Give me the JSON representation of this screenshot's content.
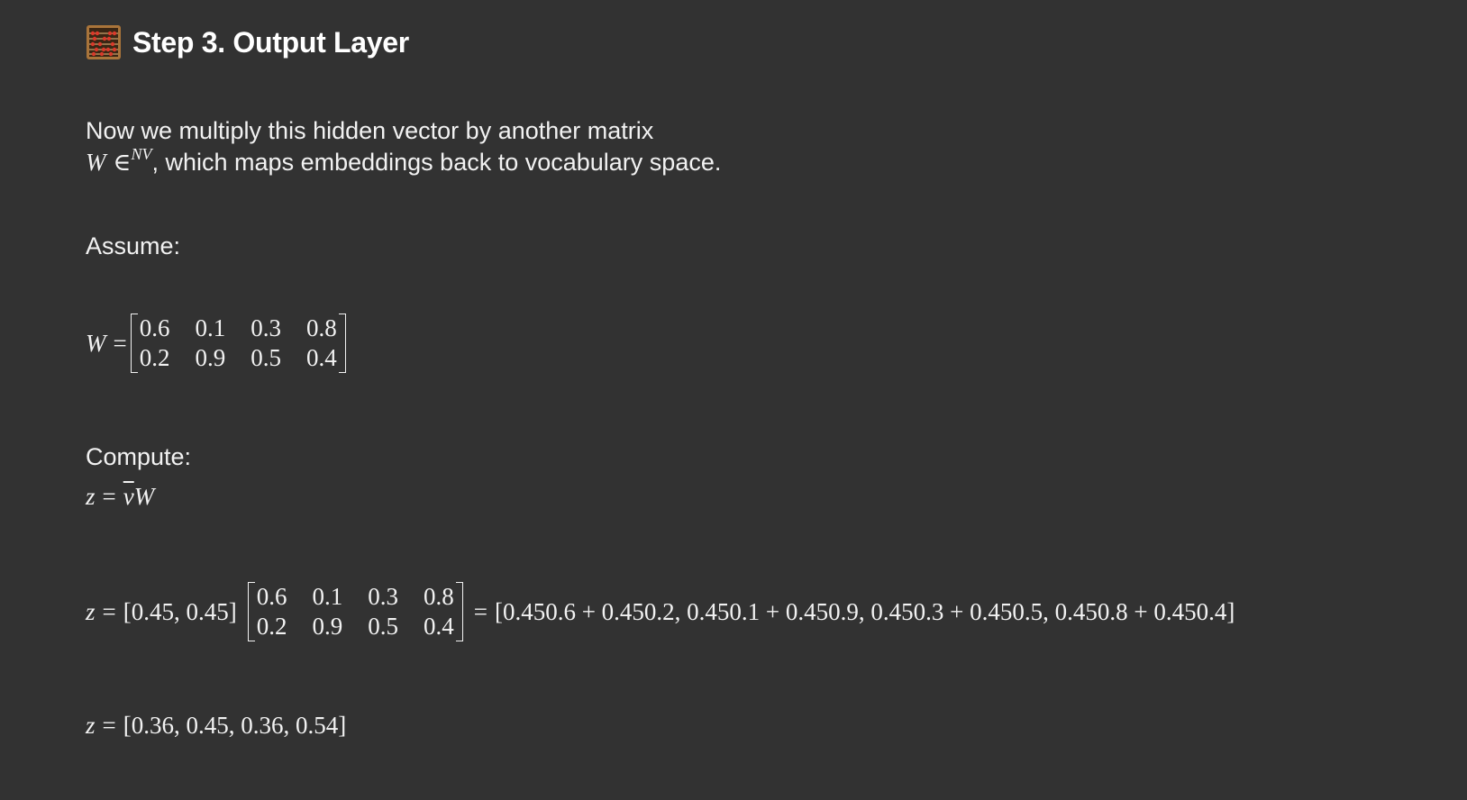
{
  "heading": {
    "icon": "abacus-icon",
    "title": "Step 3. Output Layer"
  },
  "intro": {
    "line1": "Now we multiply this hidden vector by another matrix",
    "math_W": "W",
    "math_in": "∈",
    "math_sup": "NV",
    "line2_rest": ", which maps embeddings back to vocabulary space."
  },
  "assume_label": "Assume:",
  "W_def": {
    "lhs": "W",
    "eq": "=",
    "rows": [
      [
        "0.6",
        "0.1",
        "0.3",
        "0.8"
      ],
      [
        "0.2",
        "0.9",
        "0.5",
        "0.4"
      ]
    ]
  },
  "compute_label": "Compute:",
  "formula": {
    "z": "z",
    "eq": "=",
    "v": "v",
    "W": "W"
  },
  "expansion": {
    "z": "z",
    "eq": "=",
    "vector": "[0.45, 0.45]",
    "rows": [
      [
        "0.6",
        "0.1",
        "0.3",
        "0.8"
      ],
      [
        "0.2",
        "0.9",
        "0.5",
        "0.4"
      ]
    ],
    "eq2": "=",
    "result": "[0.450.6 + 0.450.2, 0.450.1 + 0.450.9, 0.450.3 + 0.450.5, 0.450.8 + 0.450.4]"
  },
  "final": {
    "z": "z",
    "eq": "=",
    "result": "[0.36, 0.45, 0.36, 0.54]"
  }
}
